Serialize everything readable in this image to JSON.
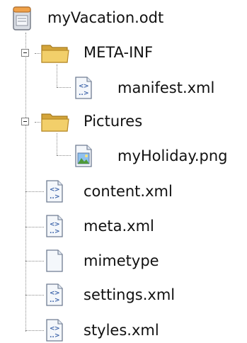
{
  "tree": {
    "root": {
      "label": "myVacation.odt",
      "icon": "document-icon"
    },
    "items": [
      {
        "label": "META-INF",
        "icon": "folder-open-icon",
        "expanded": true,
        "children": [
          {
            "label": "manifest.xml",
            "icon": "xml-file-icon"
          }
        ]
      },
      {
        "label": "Pictures",
        "icon": "folder-open-icon",
        "expanded": true,
        "children": [
          {
            "label": "myHoliday.png",
            "icon": "image-file-icon"
          }
        ]
      },
      {
        "label": "content.xml",
        "icon": "xml-file-icon"
      },
      {
        "label": "meta.xml",
        "icon": "xml-file-icon"
      },
      {
        "label": "mimetype",
        "icon": "file-icon"
      },
      {
        "label": "settings.xml",
        "icon": "xml-file-icon"
      },
      {
        "label": "styles.xml",
        "icon": "xml-file-icon"
      }
    ]
  },
  "colors": {
    "folder": "#f2cf6a",
    "folder_dark": "#d4a53a",
    "xml_blue": "#3a62a8",
    "line": "#8a8a8a"
  }
}
